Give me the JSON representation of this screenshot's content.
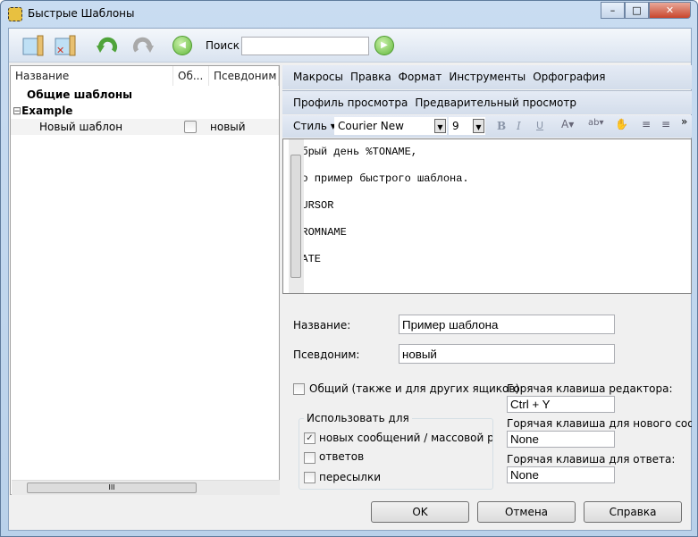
{
  "window": {
    "title": "Быстрые Шаблоны",
    "minimize": "–",
    "maximize": "□",
    "close": "✕"
  },
  "toolbar": {
    "search_label": "Поиск",
    "search_value": "",
    "icons": [
      "new-template-icon",
      "delete-template-icon",
      "undo-icon",
      "redo-icon",
      "back-icon",
      "forward-icon"
    ]
  },
  "tree": {
    "columns": [
      "Название",
      "Об...",
      "Псевдоним"
    ],
    "rows": [
      {
        "name": "Общие шаблоны"
      },
      {
        "expander": "⊟",
        "name": "Example"
      },
      {
        "name": "Новый шаблон",
        "shared": false,
        "alias": "новый"
      }
    ]
  },
  "editor_menu": [
    "Макросы",
    "Правка",
    "Формат",
    "Инструменты",
    "Орфография"
  ],
  "editor_menu2": [
    "Профиль просмотра",
    "Предварительный просмотр"
  ],
  "format": {
    "style": "Стиль",
    "font": "Courier New",
    "size": "9",
    "bold": "B",
    "italic": "I",
    "underline": "U",
    "more": "»"
  },
  "editor_lines": [
    "Добрый день %TONAME,",
    "Это пример быстрого шаблона.",
    "%CURSOR",
    "%FROMNAME",
    "%DATE"
  ],
  "form": {
    "name_label": "Название:",
    "name_value": "Пример шаблона",
    "alias_label": "Псевдоним:",
    "alias_value": "новый",
    "shared_label": "Общий (также и для других ящиков)",
    "shared": false,
    "use_for_label": "Использовать для",
    "use_for": [
      {
        "label": "новых сообщений / массовой расс",
        "checked": true
      },
      {
        "label": "ответов",
        "checked": false
      },
      {
        "label": "пересылки",
        "checked": false
      }
    ],
    "hotkey_editor_label": "Горячая клавиша редактора:",
    "hotkey_editor": "Ctrl + Y",
    "hotkey_new_label": "Горячая клавиша для нового сообще",
    "hotkey_new": "None",
    "hotkey_reply_label": "Горячая клавиша для ответа:",
    "hotkey_reply": "None"
  },
  "buttons": {
    "ok": "OK",
    "cancel": "Отмена",
    "help": "Справка"
  }
}
